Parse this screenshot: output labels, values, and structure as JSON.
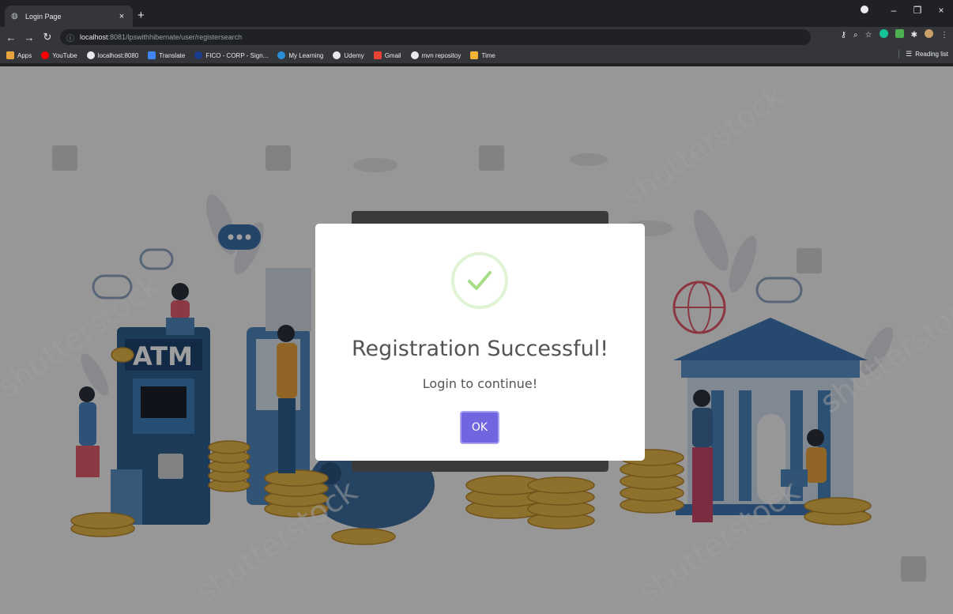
{
  "browser": {
    "tab_title": "Login Page",
    "tab_close": "×",
    "new_tab": "+",
    "url_host": "localhost",
    "url_path": ":8081/lpswithhibernate/user/registersearch",
    "window_controls": {
      "minimize": "–",
      "restore": "❐",
      "close": "×"
    },
    "bookmarks": [
      {
        "label": "Apps",
        "color": "#e8a33d"
      },
      {
        "label": "YouTube",
        "color": "#ff0000"
      },
      {
        "label": "localhost:8080",
        "color": "#e8eaed"
      },
      {
        "label": "Translate",
        "color": "#4285f4"
      },
      {
        "label": "FICO - CORP - Sign...",
        "color": "#1a3d8f"
      },
      {
        "label": "My Learning",
        "color": "#2a8fd6"
      },
      {
        "label": "Udemy",
        "color": "#e8eaed"
      },
      {
        "label": "Gmail",
        "color": "#ea4335"
      },
      {
        "label": "mvn repositoy",
        "color": "#e8eaed"
      },
      {
        "label": "Time",
        "color": "#f2b233"
      }
    ],
    "reading_list": "Reading list"
  },
  "modal": {
    "title": "Registration Successful!",
    "text": "Login to continue!",
    "ok_label": "OK",
    "accent_color": "#7066e0",
    "success_color": "#a5dc86"
  },
  "background": {
    "atm_label": "ATM",
    "watermark": "shutterstock"
  }
}
